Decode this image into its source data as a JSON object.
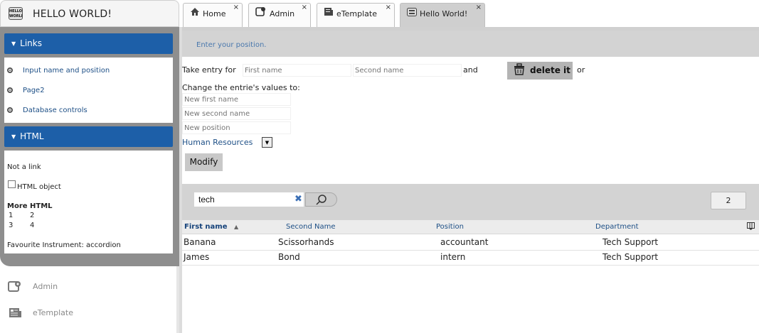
{
  "app": {
    "title": "HELLO WORLD!",
    "logo_text": "HELLO WORLD"
  },
  "tabs": [
    {
      "label": "Home"
    },
    {
      "label": "Admin"
    },
    {
      "label": "eTemplate"
    },
    {
      "label": "Hello World!"
    }
  ],
  "tab_close": "×",
  "sidebar": {
    "links_panel": {
      "title": "Links",
      "items": [
        "Input name and position",
        "Page2",
        "Database controls"
      ]
    },
    "html_panel": {
      "title": "HTML",
      "not_a_link": "Not a link",
      "checkbox_label": "HTML object",
      "more_html": "More HTML",
      "grid": [
        [
          "1",
          "2"
        ],
        [
          "3",
          "4"
        ]
      ],
      "favourite": "Favourite Instrument: accordion"
    },
    "apps": [
      {
        "label": "Admin"
      },
      {
        "label": "eTemplate"
      }
    ]
  },
  "main": {
    "hint": "Enter your position.",
    "take_entry_label": "Take entry for",
    "first_name_placeholder": "First name",
    "second_name_placeholder": "Second name",
    "and_label": "and",
    "delete_label": "delete it",
    "or_label": "or",
    "change_label": "Change the entrie's values to:",
    "new_first_placeholder": "New first name",
    "new_second_placeholder": "New second name",
    "new_position_placeholder": "New position",
    "department_selected": "Human Resources",
    "modify_label": "Modify"
  },
  "search": {
    "value": "tech",
    "count": "2"
  },
  "table": {
    "columns": [
      "First name",
      "Second Name",
      "Position",
      "Department"
    ],
    "sort_indicator": "▲",
    "rows": [
      [
        "Banana",
        "Scissorhands",
        "accountant",
        "Tech Support"
      ],
      [
        "James",
        "Bond",
        "intern",
        "Tech Support"
      ]
    ]
  }
}
